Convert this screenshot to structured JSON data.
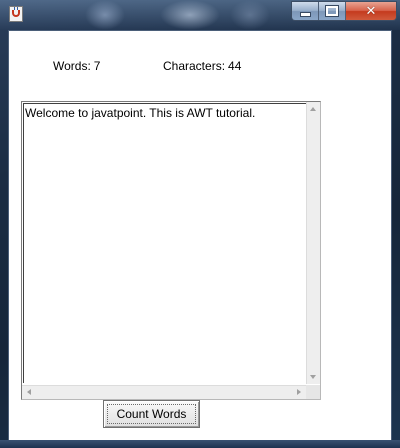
{
  "window": {
    "title": "",
    "controls": {
      "minimize_icon": "minimize-icon",
      "maximize_icon": "maximize-icon",
      "close_icon": "close-icon",
      "close_glyph": "✕"
    },
    "app_icon": "java-icon",
    "colors": {
      "close_button": "#c43a1e",
      "client_background": "#ffffff"
    }
  },
  "labels": {
    "words_text": "Words:",
    "words_value": "7",
    "chars_text": "Characters:",
    "chars_value": "44"
  },
  "textarea": {
    "value": "Welcome to javatpoint. This is AWT tutorial."
  },
  "button": {
    "count_words_label": "Count Words"
  }
}
